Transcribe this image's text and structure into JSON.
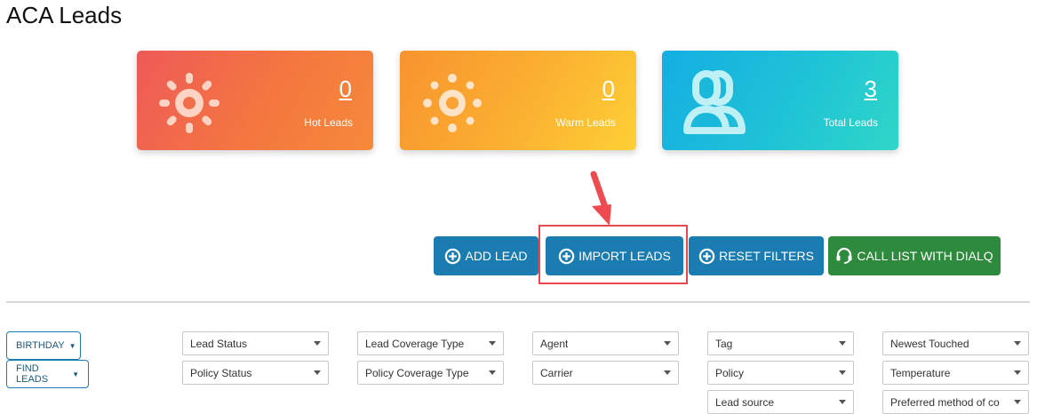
{
  "page": {
    "title": "ACA Leads"
  },
  "cards": {
    "hot": {
      "count": "0",
      "label": "Hot Leads",
      "icon": "sun-icon"
    },
    "warm": {
      "count": "0",
      "label": "Warm Leads",
      "icon": "sun-icon"
    },
    "total": {
      "count": "3",
      "label": "Total Leads",
      "icon": "users-icon"
    }
  },
  "actions": {
    "add_lead": "ADD LEAD",
    "import_leads": "IMPORT LEADS",
    "reset_filters": "RESET FILTERS",
    "call_list": "CALL LIST WITH DIALQ"
  },
  "filters": {
    "birthday": "BIRTHDAY",
    "find_leads": "FIND LEADS",
    "selects": {
      "lead_status": "Lead Status",
      "policy_status": "Policy Status",
      "lead_coverage_type": "Lead Coverage Type",
      "policy_coverage_type": "Policy Coverage Type",
      "agent": "Agent",
      "carrier": "Carrier",
      "tag": "Tag",
      "policy": "Policy",
      "lead_source": "Lead source",
      "newest_touched": "Newest Touched",
      "temperature": "Temperature",
      "preferred_contact": "Preferred method of co"
    }
  },
  "colors": {
    "primary": "#1a7cb0",
    "success": "#2e8a3c",
    "highlight": "#e8474d"
  }
}
